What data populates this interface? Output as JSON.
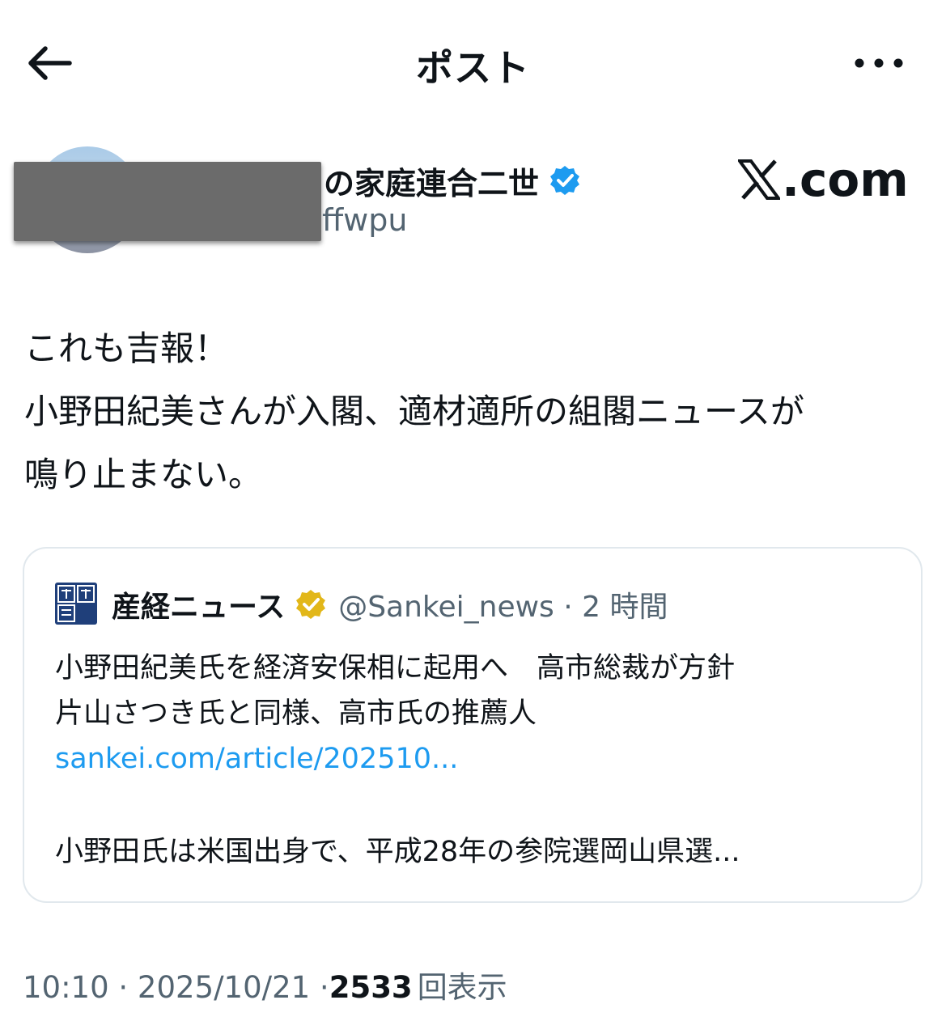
{
  "header": {
    "title": "ポスト",
    "back_icon": "arrow-left-icon",
    "more_icon": "more-horizontal-icon"
  },
  "author": {
    "name_visible": "の家庭連合二世",
    "handle_visible": "ffwpu",
    "verified_color": "#1d9bf0"
  },
  "watermark": {
    "text": ".com",
    "logo": "x-logo-icon"
  },
  "post": {
    "lines": [
      "これも吉報！",
      "小野田紀美さんが入閣、適材適所の組閣ニュースが",
      "鳴り止まない。"
    ]
  },
  "quote": {
    "name": "産経ニュース",
    "handle_time": "@Sankei_news · 2 時間",
    "gold_badge_color": "#e2b719",
    "text_lines": [
      "小野田紀美氏を経済安保相に起用へ　高市総裁が方針",
      "片山さつき氏と同様、高市氏の推薦人"
    ],
    "link": "sankei.com/article/202510...",
    "text2": "小野田氏は米国出身で、平成28年の参院選岡山県選..."
  },
  "meta": {
    "time_date": "10:10 · 2025/10/21 · ",
    "views_count": "2533",
    "views_label": "回表示"
  },
  "colors": {
    "text": "#0f1419",
    "secondary": "#536471",
    "link": "#1d9bf0",
    "border": "#e1e8ed"
  }
}
